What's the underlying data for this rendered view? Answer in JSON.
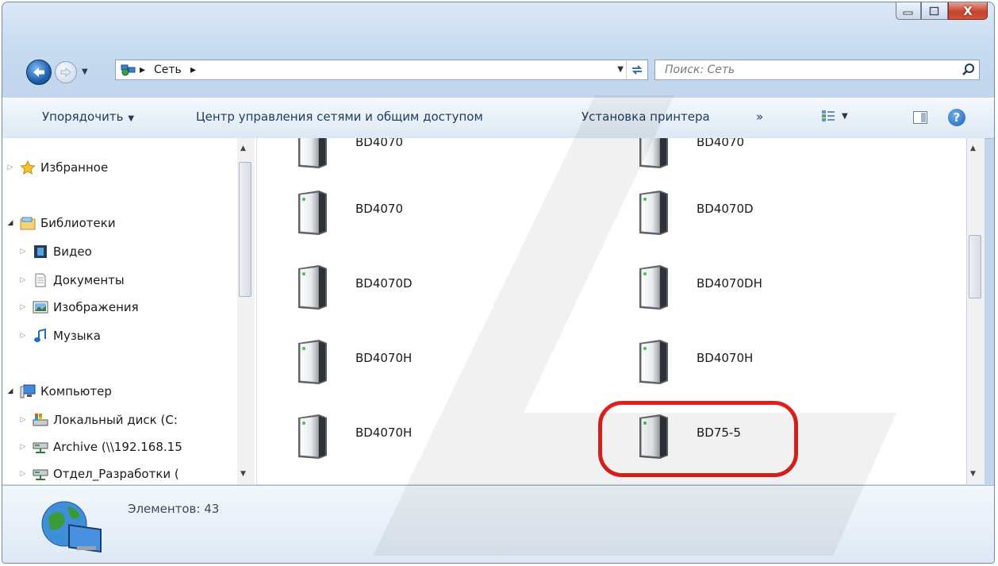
{
  "window": {
    "caption_buttons": [
      "minimize",
      "maximize",
      "close"
    ],
    "close_label": "X"
  },
  "navigation": {
    "breadcrumb": [
      "Сеть"
    ],
    "search_placeholder": "Поиск: Сеть"
  },
  "toolbar": {
    "organize_label": "Упорядочить",
    "network_center_label": "Центр управления сетями и общим доступом",
    "printer_label": "Установка принтера",
    "more_label": "»",
    "help_label": "?"
  },
  "nav_pane": {
    "favorites": "Избранное",
    "libraries": "Библиотеки",
    "video": "Видео",
    "documents": "Документы",
    "images": "Изображения",
    "music": "Музыка",
    "computer": "Компьютер",
    "local_disk": "Локальный диск (C:",
    "archive": "Archive (\\\\192.168.15",
    "dev_dept": "Отдел_Разработки ("
  },
  "devices": {
    "left": [
      "BD4070",
      "BD4070",
      "BD4070D",
      "BD4070H",
      "BD4070H"
    ],
    "right": [
      "BD4070",
      "BD4070D",
      "BD4070DH",
      "BD4070H",
      "BD75-5"
    ]
  },
  "details": {
    "count_label": "Элементов: 43"
  },
  "colors": {
    "highlight": "#e02020",
    "accent": "#1e5fae"
  }
}
